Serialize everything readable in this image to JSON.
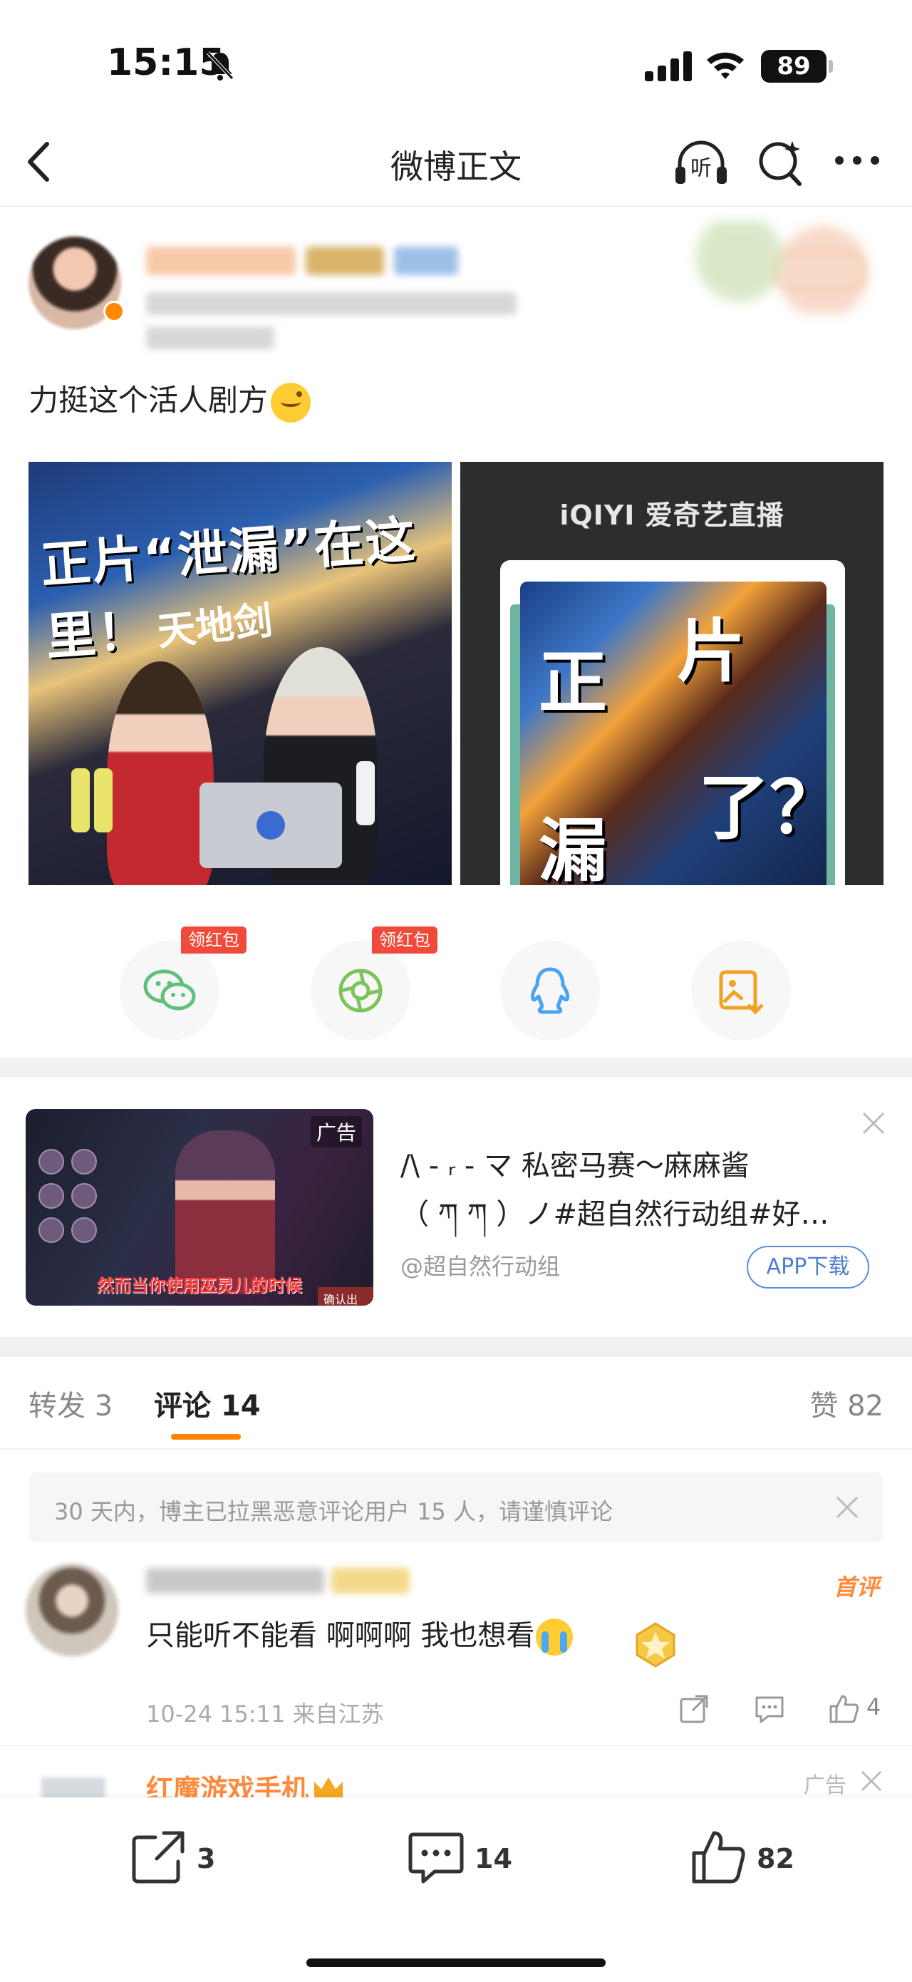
{
  "status_bar": {
    "time": "15:15",
    "battery": "89",
    "icons": [
      "bell-muted-icon",
      "signal-icon",
      "wifi-icon",
      "battery-icon"
    ]
  },
  "nav": {
    "title": "微博正文",
    "listen_label": "听",
    "icons": [
      "back-icon",
      "listen-icon",
      "search-icon",
      "more-icon"
    ]
  },
  "post": {
    "text": "力挺这个活人剧方",
    "media": [
      {
        "banner": "正片“泄漏”在这里！",
        "sub": "天地剑"
      },
      {
        "logo": "iQIYI 爱奇艺直播",
        "poster_chars": [
          "正",
          "片",
          "漏",
          "了？"
        ]
      }
    ]
  },
  "share": {
    "items": [
      {
        "name": "wechat",
        "tag": "领红包"
      },
      {
        "name": "moments",
        "tag": "领红包"
      },
      {
        "name": "qq",
        "tag": ""
      },
      {
        "name": "save-image",
        "tag": ""
      }
    ]
  },
  "ad": {
    "badge": "广告",
    "caption": "然而当你使用巫灵儿的时候",
    "confirm": "确认出勤",
    "title_line1": "/\\ - ᵣ - マ  私密马赛～麻麻酱",
    "title_line2": "（ ཀ   ཀ ）ノ#超自然行动组#好…",
    "source": "@超自然行动组",
    "button": "APP下载"
  },
  "tabs": {
    "repost": "转发 3",
    "comment": "评论 14",
    "like": "赞 82"
  },
  "notice": {
    "text": "30 天内，博主已拉黑恶意评论用户 15 人，请谨慎评论"
  },
  "comment": {
    "first_tag": "首评",
    "text": "只能听不能看 啊啊啊 我也想看",
    "meta": "10-24 15:11  来自江苏",
    "likes": "4"
  },
  "next_comment": {
    "name": "红魔游戏手机",
    "ad_label": "广告"
  },
  "bottom_bar": {
    "repost_count": "3",
    "comment_count": "14",
    "like_count": "82"
  },
  "colors": {
    "accent": "#ff8200",
    "red_tag": "#f04a3a",
    "download_blue": "#4b7fcf",
    "muted": "#999999"
  }
}
